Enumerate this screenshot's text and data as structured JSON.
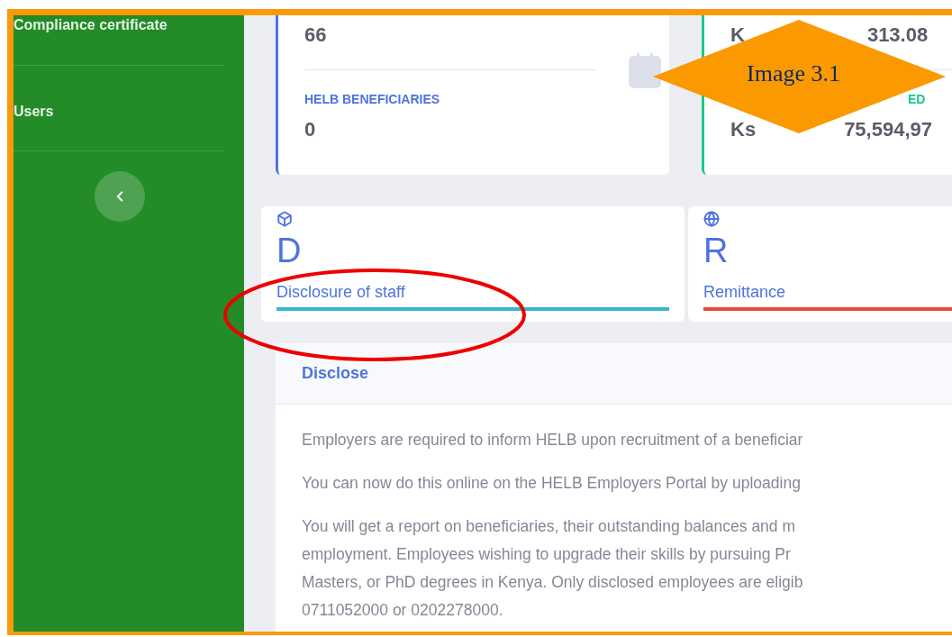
{
  "sidebar": {
    "items": [
      {
        "label": "Compliance certificate"
      },
      {
        "label": "Users"
      }
    ]
  },
  "stat_cards": [
    {
      "color": "#4e73df",
      "top_value": [
        "66"
      ],
      "label": [
        "HELB BENEFICIARIES"
      ],
      "value": [
        "0"
      ]
    },
    {
      "color": "#1cc88a",
      "top_value": [
        "K",
        "313.08"
      ],
      "label": [
        "ED"
      ],
      "value": [
        "Ks",
        "75,594,97"
      ]
    }
  ],
  "services": [
    {
      "letter": "D",
      "label": "Disclosure of staff",
      "color": "#36b9cc"
    },
    {
      "letter": "R",
      "label": "Remittance",
      "color": "#e74a3b"
    }
  ],
  "panel": {
    "title": "Disclose",
    "paragraphs": [
      [
        "Employers are required to inform HELB upon recruitment of a beneficiar"
      ],
      [
        "You can now do this online on the HELB Employers Portal by uploading"
      ],
      [
        "You will get a report on beneficiaries, their outstanding balances and m",
        "employment. Employees wishing to upgrade their skills by pursuing Pr",
        "Masters, or PhD degrees in Kenya. Only disclosed employees are eligib",
        "0711052000 or 0202278000."
      ]
    ]
  },
  "annotation": {
    "callout": "Image 3.1",
    "highlight": true
  }
}
